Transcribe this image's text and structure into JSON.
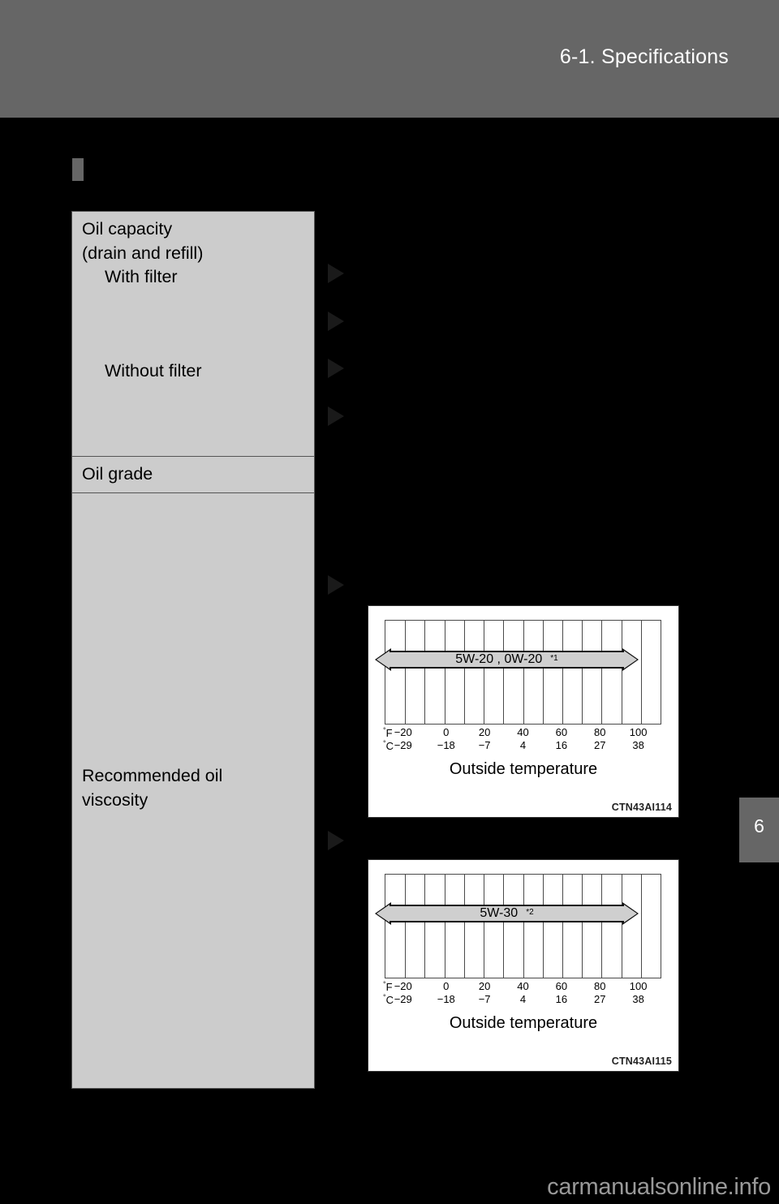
{
  "header": {
    "title": "6-1. Specifications"
  },
  "spec_table": {
    "rows": [
      {
        "label_lines": [
          "Oil capacity",
          "(drain and refill)"
        ],
        "sub_items": [
          "With filter",
          "Without filter"
        ]
      },
      {
        "label": "Oil grade"
      },
      {
        "label_lines": [
          "Recommended oil",
          "viscosity"
        ]
      }
    ],
    "oil_capacity_title": "Oil capacity",
    "oil_capacity_subtitle": "(drain and refill)",
    "with_filter": "With filter",
    "without_filter": "Without filter",
    "oil_grade": "Oil grade",
    "viscosity_line1": "Recommended oil",
    "viscosity_line2": "viscosity"
  },
  "markers": {
    "bullet_label": "section-bullet",
    "triangle_label": "bullet-arrow"
  },
  "chart_data": [
    {
      "type": "bar",
      "title": "",
      "xlabel": "Outside temperature",
      "series_label": "5W-20 , 0W-20",
      "footnote_marker": "*1",
      "code": "CTN43AI114",
      "grid": true,
      "columns": 14,
      "axes": [
        {
          "unit_symbol": "°",
          "unit": "F",
          "ticks": [
            "−20",
            "0",
            "20",
            "40",
            "60",
            "80",
            "100"
          ],
          "positions": [
            0.0667,
            0.2222,
            0.3611,
            0.5,
            0.6389,
            0.7778,
            0.9167
          ]
        },
        {
          "unit_symbol": "°",
          "unit": "C",
          "ticks": [
            "−29",
            "−18",
            "−7",
            "4",
            "16",
            "27",
            "38"
          ],
          "positions": [
            0.0667,
            0.2222,
            0.3611,
            0.5,
            0.6389,
            0.7778,
            0.9167
          ]
        }
      ],
      "range_start": 0.0,
      "range_end": 1.0
    },
    {
      "type": "bar",
      "title": "",
      "xlabel": "Outside temperature",
      "series_label": "5W-30",
      "footnote_marker": "*2",
      "code": "CTN43AI115",
      "grid": true,
      "columns": 14,
      "axes": [
        {
          "unit_symbol": "°",
          "unit": "F",
          "ticks": [
            "−20",
            "0",
            "20",
            "40",
            "60",
            "80",
            "100"
          ],
          "positions": [
            0.0667,
            0.2222,
            0.3611,
            0.5,
            0.6389,
            0.7778,
            0.9167
          ]
        },
        {
          "unit_symbol": "°",
          "unit": "C",
          "ticks": [
            "−29",
            "−18",
            "−7",
            "4",
            "16",
            "27",
            "38"
          ],
          "positions": [
            0.0667,
            0.2222,
            0.3611,
            0.5,
            0.6389,
            0.7778,
            0.9167
          ]
        }
      ],
      "range_start": 0.0,
      "range_end": 1.0
    }
  ],
  "chapter_tab": {
    "number": "6"
  },
  "watermark": {
    "text": "carmanualsonline.info"
  },
  "colors": {
    "header_band": "#666666",
    "table_fill": "#cccccc",
    "table_border": "#555555",
    "band_fill": "#cfcfcf",
    "page_background": "#000000"
  }
}
